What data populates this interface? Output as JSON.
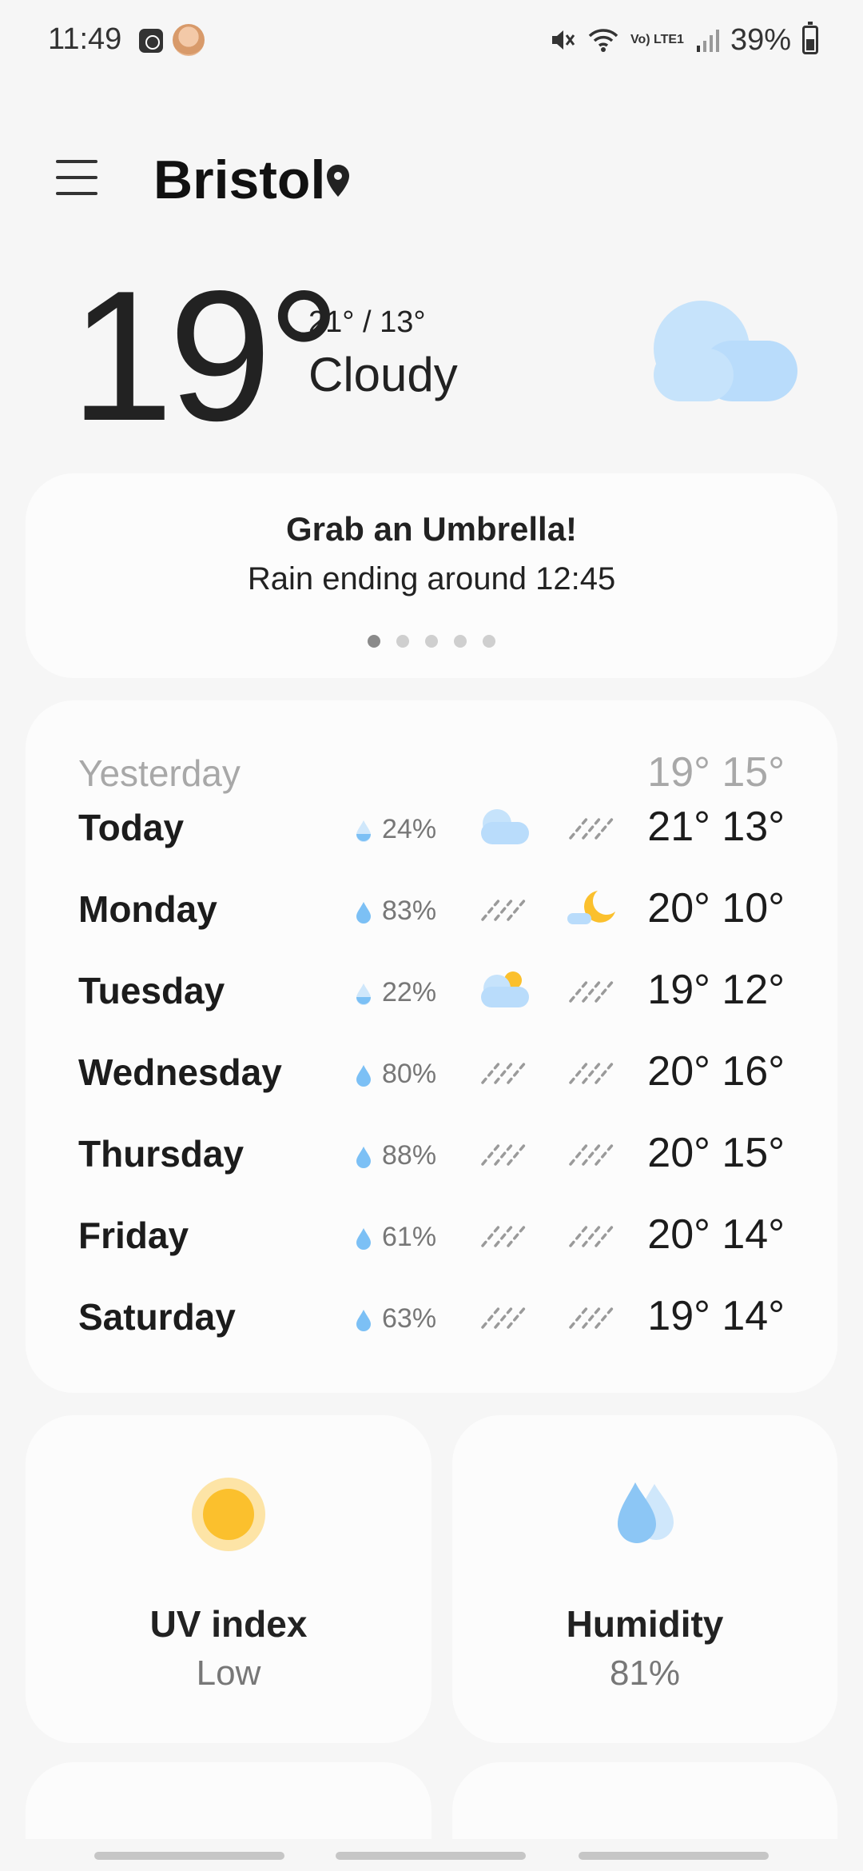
{
  "status_bar": {
    "time": "11:49",
    "volte": "Vo) LTE1",
    "battery": "39%"
  },
  "header": {
    "city": "Bristol"
  },
  "current": {
    "temperature": "19°",
    "high_low": "21° / 13°",
    "condition": "Cloudy"
  },
  "alert_card": {
    "title": "Grab an Umbrella!",
    "subtitle": "Rain ending around 12:45",
    "pages": 5,
    "active_page": 0
  },
  "forecast": {
    "yesterday": {
      "day": "Yesterday",
      "temps": "19° 15°"
    },
    "days": [
      {
        "day": "Today",
        "precip": "24%",
        "day_icon": "cloud-icon",
        "night_icon": "rain-icon",
        "temps": "21° 13°"
      },
      {
        "day": "Monday",
        "precip": "83%",
        "day_icon": "rain-icon",
        "night_icon": "moon-cloud-icon",
        "temps": "20° 10°"
      },
      {
        "day": "Tuesday",
        "precip": "22%",
        "day_icon": "sun-cloud-icon",
        "night_icon": "rain-icon",
        "temps": "19° 12°"
      },
      {
        "day": "Wednesday",
        "precip": "80%",
        "day_icon": "rain-icon",
        "night_icon": "rain-icon",
        "temps": "20° 16°"
      },
      {
        "day": "Thursday",
        "precip": "88%",
        "day_icon": "rain-icon",
        "night_icon": "rain-icon",
        "temps": "20° 15°"
      },
      {
        "day": "Friday",
        "precip": "61%",
        "day_icon": "rain-icon",
        "night_icon": "rain-icon",
        "temps": "20° 14°"
      },
      {
        "day": "Saturday",
        "precip": "63%",
        "day_icon": "rain-icon",
        "night_icon": "rain-icon",
        "temps": "19° 14°"
      }
    ]
  },
  "tiles": {
    "uv": {
      "title": "UV index",
      "value": "Low"
    },
    "humidity": {
      "title": "Humidity",
      "value": "81%"
    }
  },
  "colors": {
    "background": "#f6f6f6",
    "card": "#fcfcfc",
    "cloud": "#b9dcfb",
    "drop": "#7cc0f5",
    "sun": "#fbc02d",
    "muted": "#a8a8a8"
  }
}
